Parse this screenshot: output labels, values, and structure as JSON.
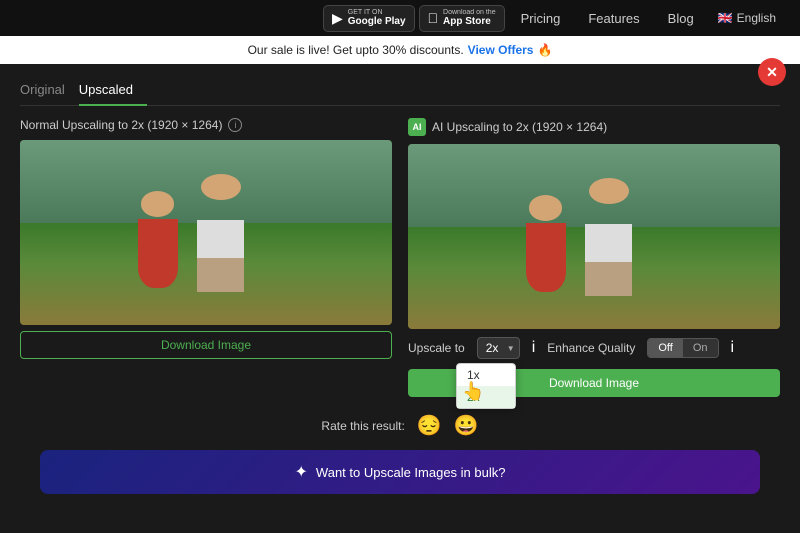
{
  "nav": {
    "google_play_small": "GET IT ON",
    "google_play_big": "Google Play",
    "app_store_small": "Download on the",
    "app_store_big": "App Store",
    "pricing": "Pricing",
    "features": "Features",
    "blog": "Blog",
    "language": "English"
  },
  "promo": {
    "text": "Our sale is live! Get upto 30% discounts.",
    "cta": "View Offers",
    "emoji": "🔥"
  },
  "tabs": [
    {
      "label": "Original",
      "active": false
    },
    {
      "label": "Upscaled",
      "active": true
    }
  ],
  "left_col": {
    "title": "Normal Upscaling to 2x (1920 × 1264)",
    "download_label": "Download Image"
  },
  "right_col": {
    "title": "AI Upscaling to 2x (1920 × 1264)",
    "upscale_label": "Upscale to",
    "upscale_value": "2x",
    "upscale_options": [
      "1x",
      "2x"
    ],
    "enhance_label": "Enhance Quality",
    "toggle_off": "Off",
    "toggle_on": "On",
    "download_label": "Download Image"
  },
  "rate": {
    "label": "Rate this result:",
    "sad_emoji": "😔",
    "happy_emoji": "😀"
  },
  "bottom_banner": {
    "text": "Want to Upscale Images in bulk?"
  }
}
